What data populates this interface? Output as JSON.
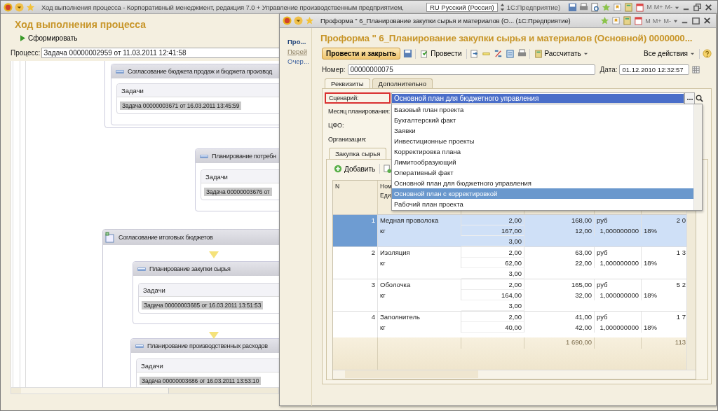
{
  "main_window": {
    "title": "Ход выполнения процесса - Корпоративный менеджмент, редакция 7.0 + Управление производственным предприятием,",
    "language": "RU Русский (Россия)",
    "title_tail": "1С:Предприятие)",
    "memory_buttons": [
      "M",
      "M+",
      "M-"
    ]
  },
  "process": {
    "heading": "Ход выполнения процесса",
    "generate_button": "Сформировать",
    "process_label": "Процесс:",
    "process_value": "Задача 00000002959 от 11.03.2011 12:41:58",
    "nodes": [
      {
        "kind": "step",
        "title": "Согласование бюджета продаж и бюджета производ",
        "tasks_label": "Задачи",
        "task": "Задача 00000003671 от 16.03.2011 13:45:59"
      },
      {
        "kind": "step",
        "title": "Планирование потребн",
        "tasks_label": "Задачи",
        "task": "Задача 00000003676 от"
      },
      {
        "kind": "group",
        "title": "Согласование итоговых бюджетов"
      },
      {
        "kind": "step",
        "title": "Планирование закупки сырья",
        "tasks_label": "Задачи",
        "task": "Задача 00000003685 от 16.03.2011 13:51:53"
      },
      {
        "kind": "step",
        "title": "Планирование производственных расходов",
        "tasks_label": "Задачи",
        "task": "Задача 00000003686 от 16.03.2011 13:53:10"
      }
    ]
  },
  "document": {
    "title": "Проформа \" 6_Планирование закупки сырья и материалов (О...  (1С:Предприятие)",
    "memory_buttons": [
      "M",
      "M+",
      "M-"
    ],
    "nav": [
      {
        "label": "Про...",
        "selected": true
      },
      {
        "label": "Перей",
        "selected": false
      },
      {
        "label": "Очер...",
        "selected": false
      }
    ],
    "heading": "Проформа \" 6_Планирование закупки сырья и материалов (Основной)  0000000...",
    "post_close_button": "Провести и закрыть",
    "post_button": "Провести",
    "calculate_button": "Рассчитать",
    "all_actions": "Все действия",
    "number_label": "Номер:",
    "number": "00000000075",
    "date_label": "Дата:",
    "date": "01.12.2010 12:32:57",
    "tabs": [
      {
        "label": "Реквизиты",
        "selected": true
      },
      {
        "label": "Дополнительно",
        "selected": false
      }
    ],
    "scenario": {
      "label": "Сценарий:",
      "highlighted": true,
      "value": "Основной план для бюджетного управления"
    },
    "other_fields": [
      "Месяц планирования:",
      "ЦФО:",
      "Организация:"
    ],
    "dropdown": [
      {
        "label": "Базовый план проекта",
        "selected": false
      },
      {
        "label": "Бухгалтерский факт",
        "selected": false
      },
      {
        "label": "Заявки",
        "selected": false
      },
      {
        "label": "Инвестиционные проекты",
        "selected": false
      },
      {
        "label": "Корректировка плана",
        "selected": false
      },
      {
        "label": "Лимитообразующий",
        "selected": false
      },
      {
        "label": "Оперативный факт",
        "selected": false
      },
      {
        "label": "Основной план для бюджетного управления",
        "selected": false
      },
      {
        "label": "Основной план с корректировкой",
        "selected": true
      },
      {
        "label": "Рабочий план проекта",
        "selected": false
      }
    ],
    "inner_tab": "Закупка сырья",
    "add_button": "Добавить",
    "table": {
      "header": {
        "n": "N",
        "name": "Ном",
        "unit": "Еди"
      },
      "rows": [
        {
          "n": "1",
          "name": "Медная проволока",
          "unit": "кг",
          "qty": [
            "2,00",
            "167,00",
            "3,00"
          ],
          "price": [
            "168,00",
            "12,00"
          ],
          "currency": "руб",
          "rate": "1,000000000",
          "vat": "18%",
          "sum": "2 0",
          "selected": true
        },
        {
          "n": "2",
          "name": "Изоляция",
          "unit": "кг",
          "qty": [
            "2,00",
            "62,00",
            "3,00"
          ],
          "price": [
            "63,00",
            "22,00"
          ],
          "currency": "руб",
          "rate": "1,000000000",
          "vat": "18%",
          "sum": "1 3",
          "selected": false
        },
        {
          "n": "3",
          "name": "Оболочка",
          "unit": "кг",
          "qty": [
            "2,00",
            "164,00",
            "3,00"
          ],
          "price": [
            "165,00",
            "32,00"
          ],
          "currency": "руб",
          "rate": "1,000000000",
          "vat": "18%",
          "sum": "5 2",
          "selected": false
        },
        {
          "n": "4",
          "name": "Заполнитель",
          "unit": "кг",
          "qty": [
            "2,00",
            "40,00"
          ],
          "price": [
            "41,00",
            "42,00"
          ],
          "currency": "руб",
          "rate": "1,000000000",
          "vat": "18%",
          "sum": "1 7",
          "selected": false
        }
      ],
      "totals": {
        "price": "1 690,00",
        "sum": "113"
      }
    }
  }
}
